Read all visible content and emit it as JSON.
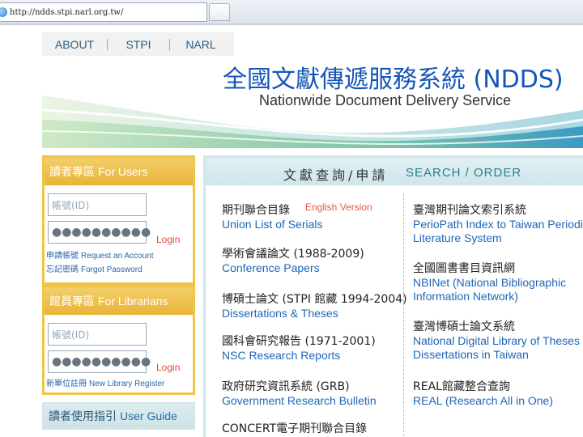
{
  "browser": {
    "url": "http://ndds.stpi.narl.org.tw/"
  },
  "banner": {
    "nav": [
      "ABOUT",
      "STPI",
      "NARL"
    ],
    "title_cn": "全國文獻傳遞服務系統 (NDDS)",
    "title_en": "Nationwide Document Delivery Service"
  },
  "users_panel": {
    "title_cn": "讀者專區",
    "title_en": "For Users",
    "id_placeholder": "帳號(ID)",
    "password_mask": "●●●●●●●●●●",
    "login": "Login",
    "request_cn": "申請帳號",
    "request_en": "Request an Account",
    "forgot_cn": "忘記密碼",
    "forgot_en": "Forgot Password"
  },
  "librarians_panel": {
    "title_cn": "館員專區",
    "title_en": "For Librarians",
    "id_placeholder": "帳號(ID)",
    "password_mask": "●●●●●●●●●●",
    "login": "Login",
    "register_cn": "新單位註冊",
    "register_en": "New Library Register"
  },
  "guide": {
    "title_cn": "讀者使用指引",
    "title_en": "User Guide"
  },
  "search": {
    "heading_cn": "文獻查詢/申請",
    "heading_en": "SEARCH / ORDER",
    "english_version": "English Version",
    "left_items": [
      {
        "cn": "期刊聯合目錄",
        "en": "Union List of Serials"
      },
      {
        "cn": "學術會議論文 (1988-2009)",
        "en": "Conference Papers"
      },
      {
        "cn": "博碩士論文 (STPI 館藏 1994-2004)",
        "en": "Dissertations & Theses"
      },
      {
        "cn": "國科會研究報告 (1971-2001)",
        "en": "NSC Research Reports"
      },
      {
        "cn": "政府研究資訊系統 (GRB)",
        "en": "Government Research Bulletin"
      },
      {
        "cn": "CONCERT電子期刊聯合目錄",
        "en": ""
      }
    ],
    "right_items": [
      {
        "cn": "臺灣期刊論文索引系統",
        "en1": "PerioPath Index to Taiwan Periodic",
        "en2": "Literature System"
      },
      {
        "cn": "全國圖書書目資訊網",
        "en1": "NBINet (National Bibliographic",
        "en2": "Information Network)"
      },
      {
        "cn": "臺灣博碩士論文系統",
        "en1": "National Digital Library of Theses and",
        "en2": "Dissertations in Taiwan"
      },
      {
        "cn": "REAL館藏整合查詢",
        "en1": "REAL (Research All in One)",
        "en2": ""
      }
    ]
  }
}
